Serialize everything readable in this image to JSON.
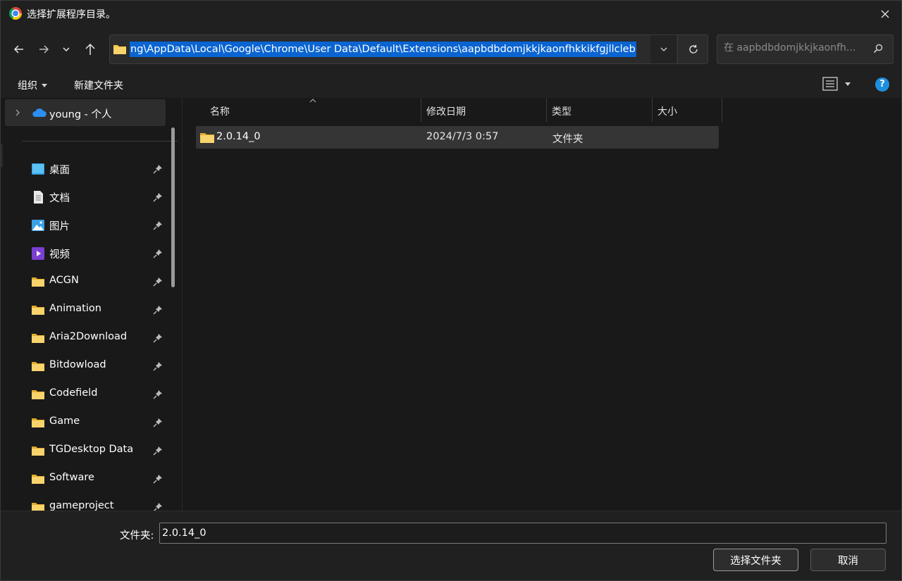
{
  "window": {
    "title": "选择扩展程序目录。"
  },
  "navbar": {
    "address_path": "ng\\AppData\\Local\\Google\\Chrome\\User Data\\Default\\Extensions\\aapbdbdomjkkjkaonfhkkikfgjllcleb",
    "search_placeholder": "在 aapbdbdomjkkjkaonfh..."
  },
  "cmdbar": {
    "organize_label": "组织",
    "new_folder_label": "新建文件夹"
  },
  "sidebar": {
    "top_item": "young - 个人",
    "items": [
      {
        "label": "桌面",
        "icon": "desktop-icon"
      },
      {
        "label": "文档",
        "icon": "document-icon"
      },
      {
        "label": "图片",
        "icon": "pictures-icon"
      },
      {
        "label": "视频",
        "icon": "videos-icon"
      },
      {
        "label": "ACGN",
        "icon": "folder-icon"
      },
      {
        "label": "Animation",
        "icon": "folder-icon"
      },
      {
        "label": "Aria2Download",
        "icon": "folder-icon"
      },
      {
        "label": "Bitdowload",
        "icon": "folder-icon"
      },
      {
        "label": "Codefield",
        "icon": "folder-icon"
      },
      {
        "label": "Game",
        "icon": "folder-icon"
      },
      {
        "label": "TGDesktop Data",
        "icon": "folder-icon"
      },
      {
        "label": "Software",
        "icon": "folder-icon"
      },
      {
        "label": "gameproject",
        "icon": "folder-icon"
      }
    ]
  },
  "filelist": {
    "columns": {
      "name": "名称",
      "modified": "修改日期",
      "type": "类型",
      "size": "大小"
    },
    "rows": [
      {
        "name": "2.0.14_0",
        "modified": "2024/7/3 0:57",
        "type": "文件夹",
        "size": ""
      }
    ]
  },
  "bottom": {
    "folder_label": "文件夹:",
    "folder_value": "2.0.14_0",
    "select_button": "选择文件夹",
    "cancel_button": "取消"
  },
  "colors": {
    "accent": "#0a64d1",
    "folder": "#f5c542",
    "help": "#1e8fde"
  }
}
